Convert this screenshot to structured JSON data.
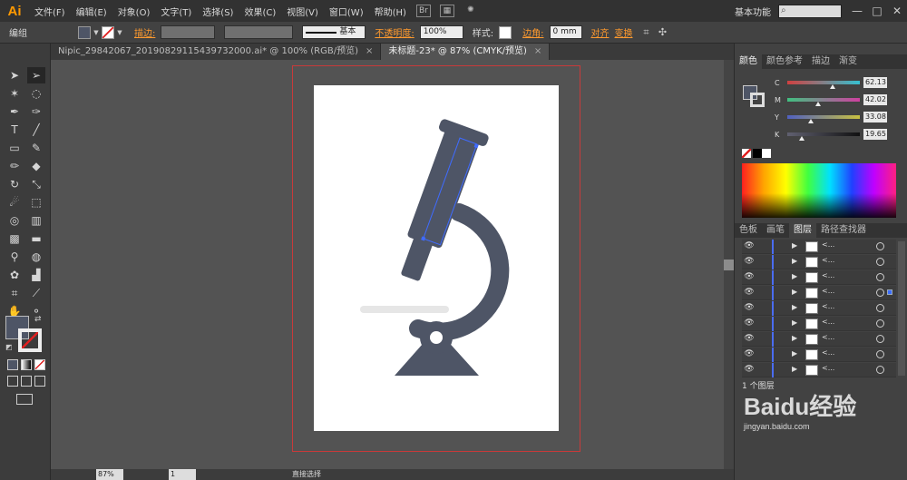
{
  "app": {
    "logo": "Ai",
    "workspace_label": "基本功能",
    "window_controls": [
      "—",
      "□",
      "✕"
    ]
  },
  "menu": [
    "文件(F)",
    "编辑(E)",
    "对象(O)",
    "文字(T)",
    "选择(S)",
    "效果(C)",
    "视图(V)",
    "窗口(W)",
    "帮助(H)"
  ],
  "controlbar": {
    "group_label": "编组",
    "stroke_label": "描边:",
    "stroke_style": "基本",
    "opacity_label": "不透明度:",
    "opacity_value": "100%",
    "style_label": "样式:",
    "corner_label": "边角:",
    "corner_value": "0 mm",
    "align_label": "对齐",
    "transform_label": "变换"
  },
  "tabs": [
    {
      "label": "Nipic_29842067_20190829115439732000.ai* @ 100% (RGB/预览)",
      "close": "×"
    },
    {
      "label": "未标题-23* @ 87% (CMYK/预览)",
      "close": "×"
    }
  ],
  "status": {
    "zoom": "87%",
    "page": "1",
    "tool_name": "直接选择"
  },
  "color_panel": {
    "tabs": [
      "颜色",
      "颜色参考",
      "描边",
      "渐变"
    ],
    "channels": [
      {
        "label": "C",
        "value": "62.13",
        "fraction": 0.62
      },
      {
        "label": "M",
        "value": "42.02",
        "fraction": 0.42
      },
      {
        "label": "Y",
        "value": "33.08",
        "fraction": 0.33
      },
      {
        "label": "K",
        "value": "19.65",
        "fraction": 0.2
      }
    ],
    "colors": {
      "fill": "#4e5566",
      "c": "#35c0d0",
      "m": "#d040a0",
      "y": "#c8c040",
      "k": "#888888"
    }
  },
  "layers_panel": {
    "tabs": [
      "色板",
      "画笔",
      "图层",
      "路径查找器"
    ],
    "rows": [
      {
        "name": "<..."
      },
      {
        "name": "<..."
      },
      {
        "name": "<..."
      },
      {
        "name": "<..."
      },
      {
        "name": "<..."
      },
      {
        "name": "<..."
      },
      {
        "name": "<..."
      },
      {
        "name": "<..."
      },
      {
        "name": "<..."
      }
    ],
    "footer": "1 个图层"
  },
  "artwork": {
    "body_color": "#4e5566",
    "shadow_color": "#e6e6e6",
    "light_color": "#ffffff"
  },
  "watermark": {
    "text": "Baidu经验",
    "sub": "jingyan.baidu.com"
  }
}
